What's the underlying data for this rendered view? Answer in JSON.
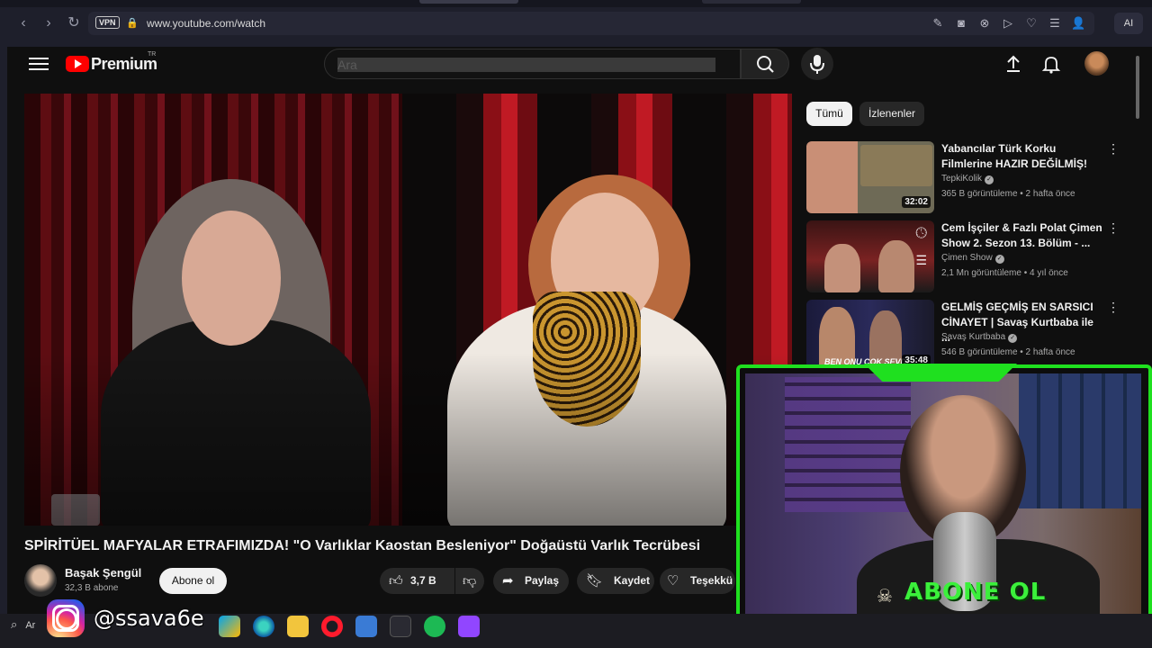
{
  "browser": {
    "url": "www.youtube.com/watch",
    "vpn_label": "VPN",
    "ai_label": "AI"
  },
  "header": {
    "brand": "Premium",
    "region": "TR",
    "search_placeholder": "Ara"
  },
  "video": {
    "title": "SPİRİTÜEL MAFYALAR ETRAFIMIZDA! \"O Varlıklar Kaostan Besleniyor\" Doğaüstü Varlık Tecrübesi",
    "channel": "Başak Şengül",
    "subscribers": "32,3 B abone",
    "subscribe_label": "Abone ol",
    "likes": "3,7 B",
    "share_label": "Paylaş",
    "save_label": "Kaydet",
    "thanks_label": "Teşekkü"
  },
  "sidebar": {
    "chips": [
      {
        "label": "Tümü",
        "selected": true
      },
      {
        "label": "İzlenenler",
        "selected": false
      }
    ],
    "recommendations": [
      {
        "title": "Yabancılar Türk Korku Filmlerine HAZIR DEĞİLMİŞ!",
        "channel": "TepkiKolik",
        "meta": "365 B görüntüleme • 2 hafta önce",
        "duration": "32:02"
      },
      {
        "title": "Cem İşçiler & Fazlı Polat Çimen Show 2. Sezon 13. Bölüm - ...",
        "channel": "Çimen Show",
        "meta": "2,1 Mn görüntüleme • 4 yıl önce",
        "duration": ""
      },
      {
        "title": "GELMİŞ GEÇMİŞ EN SARSICI CİNAYET | Savaş Kurtbaba ile ...",
        "channel": "Savaş Kurtbaba",
        "meta": "546 B görüntüleme • 2 hafta önce",
        "duration": "35:48",
        "thumb_caption": "BEN ONU ÇOK SEVDİ"
      }
    ]
  },
  "overlay": {
    "abone_text": "ABONE OL",
    "instagram_handle": "@ssava6e",
    "accent_color": "#1fe01f"
  },
  "taskbar": {
    "search_label": "Ar"
  }
}
